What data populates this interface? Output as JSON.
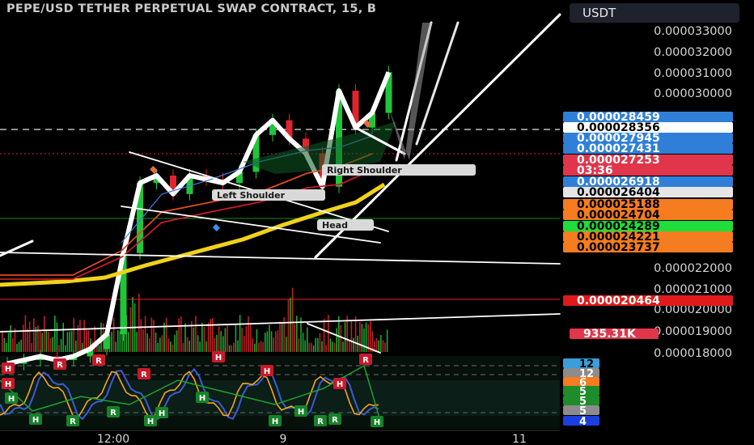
{
  "header": {
    "title": "PEPE/USD TETHER PERPETUAL SWAP CONTRACT, 15, B",
    "currency": "USDT"
  },
  "chart_data": {
    "type": "line",
    "price_axis": {
      "ticks": [
        "0.000033000",
        "0.000032000",
        "0.000031000",
        "0.000030000",
        "0.000023000",
        "0.000022000",
        "0.000021000",
        "0.000020000",
        "0.000019000",
        "0.000018000"
      ],
      "ylim": [
        1.8e-05,
        3.4e-05
      ]
    },
    "price_labels": [
      {
        "value": "0.000028459",
        "color": "#2f7fd8",
        "text_color": "#ffffff"
      },
      {
        "value": "0.000028356",
        "color": "#ffffff",
        "text_color": "#000000"
      },
      {
        "value": "0.000027945",
        "color": "#2f7fd8",
        "text_color": "#ffffff"
      },
      {
        "value": "0.000027431",
        "color": "#2f7fd8",
        "text_color": "#ffffff"
      },
      {
        "value": "0.000027253",
        "color": "#e0354a",
        "text_color": "#ffffff"
      },
      {
        "value": "03:36",
        "color": "#e0354a",
        "text_color": "#ffffff"
      },
      {
        "value": "0.000026918",
        "color": "#2f7fd8",
        "text_color": "#ffffff"
      },
      {
        "value": "0.000026404",
        "color": "#e6e6e6",
        "text_color": "#000000"
      },
      {
        "value": "0.000025188",
        "color": "#f57c1f",
        "text_color": "#000000"
      },
      {
        "value": "0.000024704",
        "color": "#f57c1f",
        "text_color": "#000000"
      },
      {
        "value": "0.000024289",
        "color": "#1fdd3a",
        "text_color": "#000000"
      },
      {
        "value": "0.000024221",
        "color": "#f57c1f",
        "text_color": "#000000"
      },
      {
        "value": "0.000023737",
        "color": "#f57c1f",
        "text_color": "#000000"
      },
      {
        "value": "0.000020464",
        "color": "#e01a1a",
        "text_color": "#ffffff"
      },
      {
        "value": "935.31K",
        "color": "#e0354a",
        "text_color": "#ffffff"
      }
    ],
    "oscillator_labels": [
      {
        "value": "12",
        "color": "#3a9fd8",
        "text_color": "#000000"
      },
      {
        "value": "12",
        "color": "#8c8c8c",
        "text_color": "#ffffff"
      },
      {
        "value": "6",
        "color": "#f57c1f",
        "text_color": "#ffffff"
      },
      {
        "value": "5",
        "color": "#1e8c2a",
        "text_color": "#ffffff"
      },
      {
        "value": "5",
        "color": "#1e8c2a",
        "text_color": "#ffffff"
      },
      {
        "value": "5",
        "color": "#8c8c8c",
        "text_color": "#ffffff"
      },
      {
        "value": "4",
        "color": "#1a3fe0",
        "text_color": "#ffffff"
      }
    ],
    "time_axis": {
      "ticks": [
        "12:00",
        "9",
        "11"
      ]
    },
    "annotations": [
      "Right Shoulder",
      "Left Shoulder",
      "Head"
    ],
    "pivot_markers": {
      "high": "H",
      "reversal": "R"
    },
    "price_series": [
      1.94e-05,
      1.95e-05,
      1.96e-05,
      1.95e-05,
      1.96e-05,
      1.98e-05,
      2.02e-05,
      2.24e-05,
      2.43e-05,
      2.45e-05,
      2.4e-05,
      2.45e-05,
      2.44e-05,
      2.43e-05,
      2.46e-05,
      2.56e-05,
      2.6e-05,
      2.55e-05,
      2.51e-05,
      2.42e-05,
      2.68e-05,
      2.58e-05,
      2.62e-05,
      2.73e-05
    ],
    "colors": {
      "bull": "#1fc63a",
      "bear": "#e0242e",
      "ema_slow": "#f0d21a",
      "ema_fast": "#ffffff"
    }
  }
}
